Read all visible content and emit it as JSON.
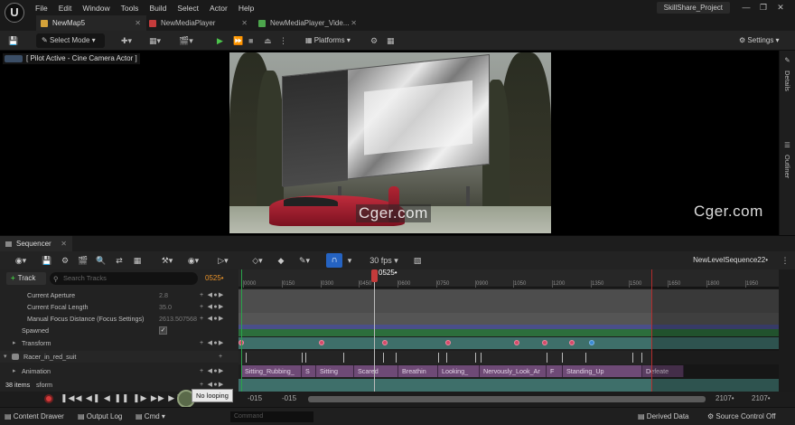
{
  "menubar": {
    "logo": "U",
    "menus": [
      "File",
      "Edit",
      "Window",
      "Tools",
      "Build",
      "Select",
      "Actor",
      "Help"
    ],
    "project": "SkillShare_Project"
  },
  "tabs": [
    {
      "label": "NewMap5",
      "color": "#d4a23a"
    },
    {
      "label": "NewMediaPlayer",
      "color": "#c43b3b"
    },
    {
      "label": "NewMediaPlayer_Vide...",
      "color": "#4ca54c"
    }
  ],
  "toolbar": {
    "select_mode": "Select Mode",
    "platforms": "Platforms",
    "settings": "Settings"
  },
  "viewport": {
    "tag": "[ Pilot Active - Cine Camera Actor ]",
    "watermark": "Cger.com"
  },
  "sidepanel": {
    "details": "Details",
    "outliner": "Outliner"
  },
  "sequencer": {
    "tab": "Sequencer",
    "fps": "30 fps",
    "sequence_name": "NewLevelSequence22•",
    "track_button": "Track",
    "search_placeholder": "Search Tracks",
    "current_frame": "0525•",
    "playhead_label": "0525•",
    "item_count": "38 items",
    "tracks": [
      {
        "label": "Current Aperture",
        "value": "2.8"
      },
      {
        "label": "Current Focal Length",
        "value": "35.0"
      },
      {
        "label": "Manual Focus Distance (Focus Settings)",
        "value": "2613.507568"
      },
      {
        "label": "Spawned",
        "value": ""
      },
      {
        "label": "Transform",
        "value": ""
      },
      {
        "label": "Racer_in_red_suit",
        "value": ""
      },
      {
        "label": "Animation",
        "value": ""
      },
      {
        "label": "sform",
        "value": ""
      }
    ],
    "ruler_ticks": [
      "0000",
      "0150",
      "0300",
      "0450",
      "0600",
      "0750",
      "0900",
      "1050",
      "1200",
      "1350",
      "1500",
      "1650",
      "1800",
      "1950"
    ],
    "animation_clips": [
      "Sitting_Rubbing_",
      "S",
      "Sitting",
      "Scared",
      "Breathin",
      "Looking_",
      "Nervously_Look_Ar",
      "F",
      "Standing_Up",
      "Defeate"
    ],
    "range_start_a": "-015",
    "range_start_b": "-015",
    "range_end_a": "2107•",
    "range_end_b": "2107•",
    "loop_tooltip": "No looping"
  },
  "statusbar": {
    "content_drawer": "Content Drawer",
    "output_log": "Output Log",
    "cmd": "Cmd",
    "cmd_placeholder": "Command",
    "derived_data": "Derived Data",
    "source_control": "Source Control Off"
  }
}
